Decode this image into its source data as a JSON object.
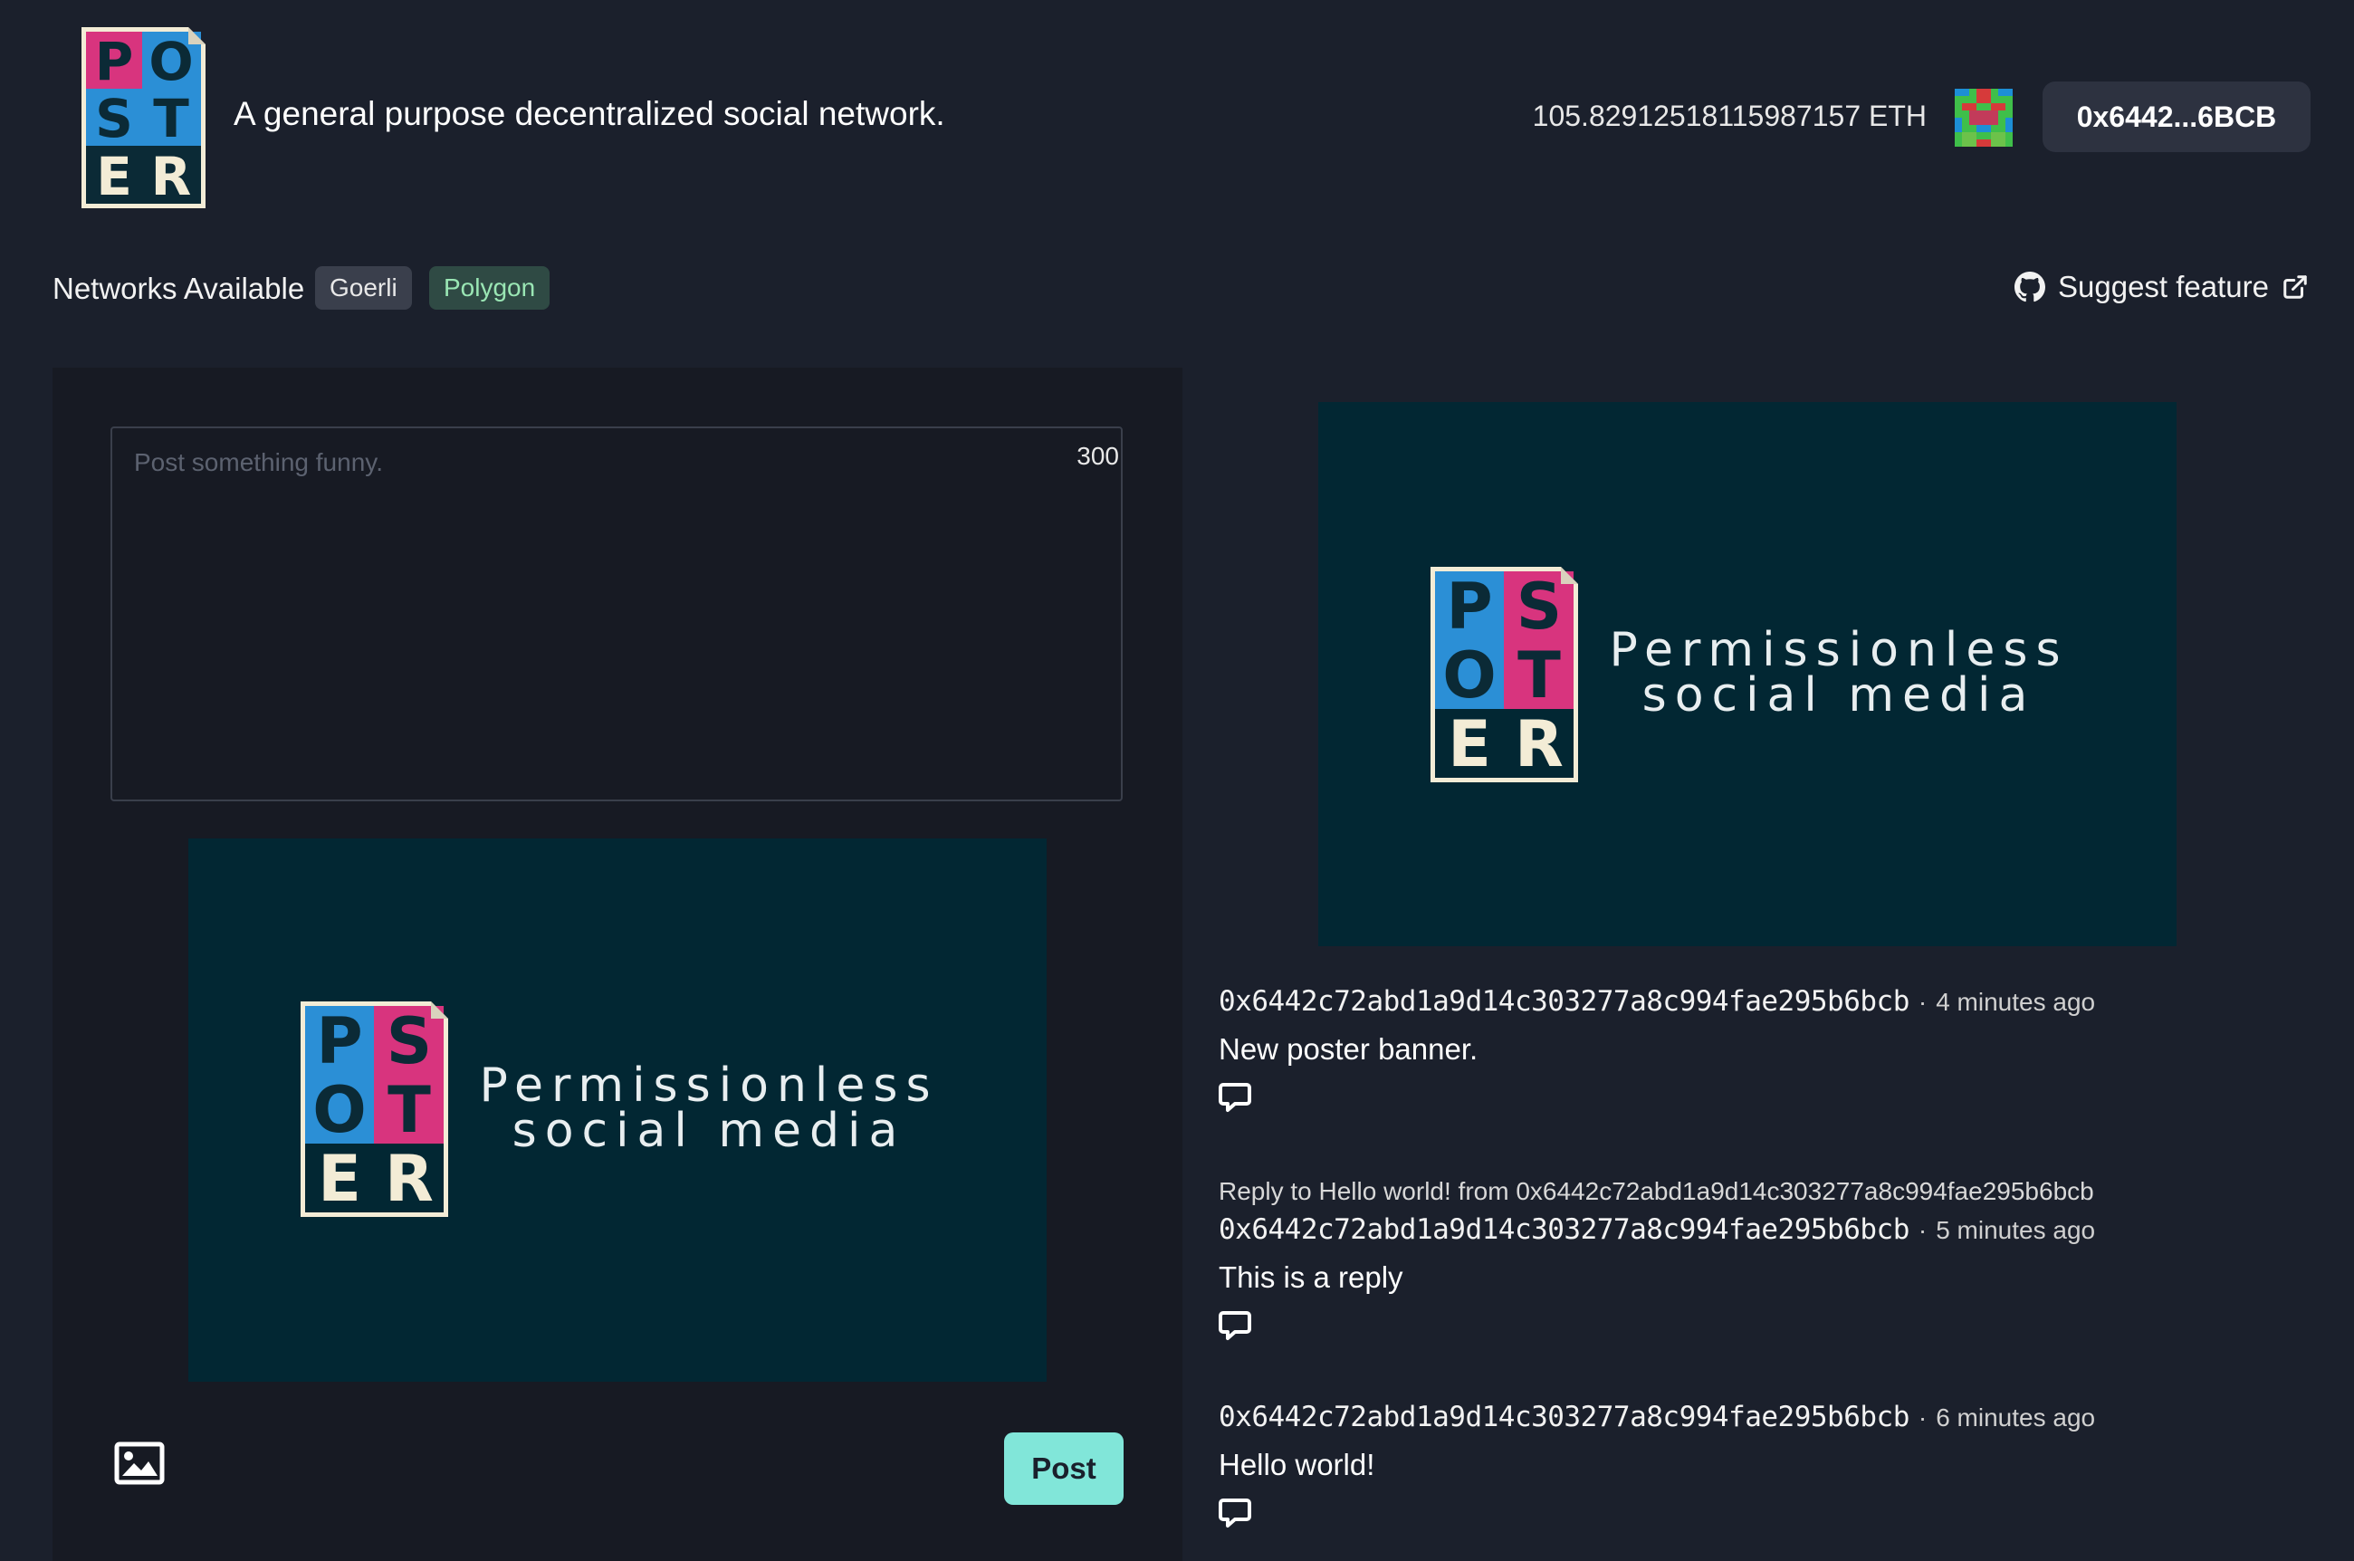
{
  "header": {
    "logo_letters": [
      "P",
      "O",
      "S",
      "T",
      "E",
      "R"
    ],
    "tagline": "A general purpose decentralized social network.",
    "balance": "105.82912518115987157 ETH",
    "account_button": "0x6442...6BCB"
  },
  "networks": {
    "label": "Networks Available",
    "items": [
      "Goerli",
      "Polygon"
    ]
  },
  "suggest": {
    "label": "Suggest feature",
    "icons": [
      "github-icon",
      "external-link-icon"
    ]
  },
  "composer": {
    "placeholder": "Post something funny.",
    "value": "",
    "char_count": "300",
    "banner": {
      "logo_letters": [
        "P",
        "S",
        "O",
        "T",
        "E",
        "R"
      ],
      "line1": "Permissionless",
      "line2": "social media"
    },
    "image_icon": "image-icon",
    "post_label": "Post"
  },
  "feed": {
    "banner": {
      "logo_letters": [
        "P",
        "S",
        "O",
        "T",
        "E",
        "R"
      ],
      "line1": "Permissionless",
      "line2": "social media"
    },
    "posts": [
      {
        "author": "0x6442c72abd1a9d14c303277a8c994fae295b6bcb",
        "separator": "·",
        "time": "4 minutes ago",
        "body": "New poster banner.",
        "reply_to": ""
      },
      {
        "reply_to": "Reply to Hello world! from 0x6442c72abd1a9d14c303277a8c994fae295b6bcb",
        "author": "0x6442c72abd1a9d14c303277a8c994fae295b6bcb",
        "separator": "·",
        "time": "5 minutes ago",
        "body": "This is a reply"
      },
      {
        "author": "0x6442c72abd1a9d14c303277a8c994fae295b6bcb",
        "separator": "·",
        "time": "6 minutes ago",
        "body": "Hello world!",
        "reply_to": ""
      }
    ]
  },
  "colors": {
    "background": "#1b202c",
    "panel": "#171a23",
    "accent_teal": "#81e6d9",
    "logo_blue": "#2b8fd6",
    "logo_pink": "#d8347e",
    "logo_dark": "#0b2a36",
    "banner_bg": "#022733",
    "logo_cream": "#f3ecd6"
  }
}
